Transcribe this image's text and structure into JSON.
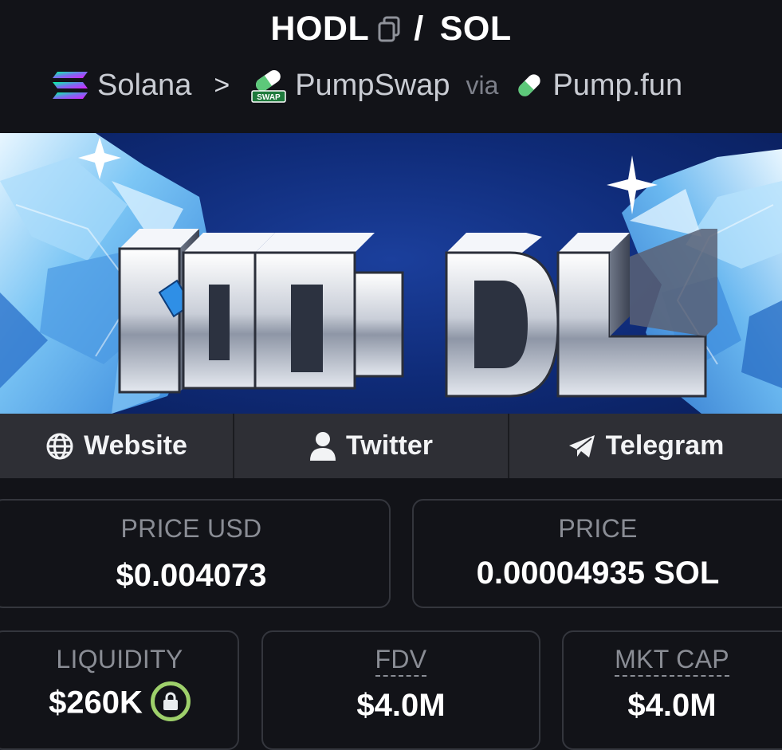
{
  "header": {
    "base_symbol": "HODL",
    "separator": "/",
    "quote_symbol": "SOL",
    "breadcrumb": {
      "chain": "Solana",
      "chevron": ">",
      "dex": "PumpSwap",
      "dex_badge": "SWAP",
      "via": "via",
      "launchpad": "Pump.fun"
    }
  },
  "banner": {
    "text_letters": [
      "H",
      "O",
      "D",
      "L"
    ]
  },
  "links": [
    {
      "label": "Website",
      "icon": "globe-icon"
    },
    {
      "label": "Twitter",
      "icon": "user-icon"
    },
    {
      "label": "Telegram",
      "icon": "telegram-icon"
    }
  ],
  "stats": {
    "price_usd": {
      "label": "PRICE USD",
      "value": "$0.004073"
    },
    "price": {
      "label": "PRICE",
      "value": "0.00004935 SOL"
    },
    "liquidity": {
      "label": "LIQUIDITY",
      "value": "$260K",
      "icon": "lock-icon"
    },
    "fdv": {
      "label": "FDV",
      "value": "$4.0M"
    },
    "mkt_cap": {
      "label": "MKT CAP",
      "value": "$4.0M"
    }
  },
  "colors": {
    "background": "#121318",
    "card_border": "#34363d",
    "link_bg": "#2e2f35",
    "label_gray": "#8a8d95",
    "lock_green": "#9ed06b",
    "banner_blue": "#0f2b78"
  }
}
